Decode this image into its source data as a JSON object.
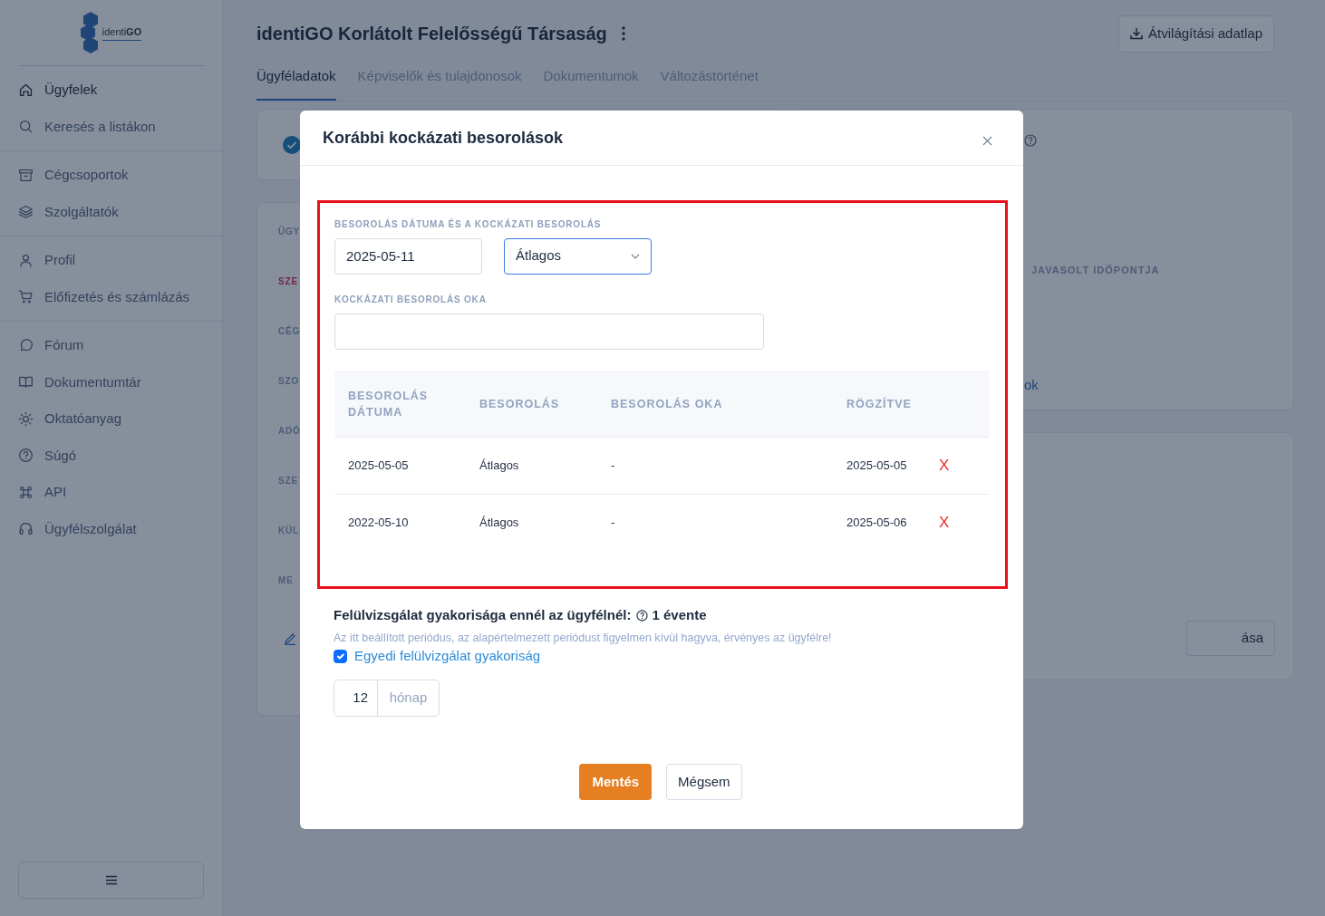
{
  "sidebar": {
    "logo_text": "identi**GO**",
    "groups": [
      [
        {
          "label": "Ügyfelek",
          "selected": true
        },
        {
          "label": "Keresés a listákon",
          "selected": false
        }
      ],
      [
        {
          "label": "Cégcsoportok",
          "selected": false
        },
        {
          "label": "Szolgáltatók",
          "selected": false
        }
      ],
      [
        {
          "label": "Profil",
          "selected": false
        },
        {
          "label": "Előfizetés és számlázás",
          "selected": false
        }
      ],
      [
        {
          "label": "Fórum",
          "selected": false
        },
        {
          "label": "Dokumentumtár",
          "selected": false
        },
        {
          "label": "Oktatóanyag",
          "selected": false
        },
        {
          "label": "Súgó",
          "selected": false
        },
        {
          "label": "API",
          "selected": false
        },
        {
          "label": "Ügyfélszolgálat",
          "selected": false
        }
      ]
    ]
  },
  "page": {
    "title": "identiGO Korlátolt Felelősségű Társaság",
    "download_button": "Átvilágítási adatlap",
    "tabs": [
      {
        "label": "Ügyféladatok",
        "selected": true
      },
      {
        "label": "Képviselők és tulajdonosok",
        "selected": false
      },
      {
        "label": "Dokumentumok",
        "selected": false
      },
      {
        "label": "Változástörténet",
        "selected": false
      }
    ],
    "left_labels": [
      {
        "text": "ÜGY",
        "alert": false
      },
      {
        "text": "SZE",
        "alert": true
      },
      {
        "text": "CÉG",
        "alert": false
      },
      {
        "text": "SZO",
        "alert": false
      },
      {
        "text": "ADÓ",
        "alert": false
      },
      {
        "text": "SZE",
        "alert": false
      },
      {
        "text": "KÜL",
        "alert": false
      },
      {
        "text": "ME",
        "alert": false
      }
    ],
    "right_label": "JAVASOLT IDŐPONTJA",
    "right_link": "ok",
    "right_button": "ása"
  },
  "modal": {
    "title": "Korábbi kockázati besorolások",
    "section_label": "BESOROLÁS DÁTUMA ÉS A KOCKÁZATI BESOROLÁS",
    "date_value": "2025-05-11",
    "rating_value": "Átlagos",
    "reason_label": "KOCKÁZATI BESOROLÁS OKA",
    "table": {
      "columns": [
        "BESOROLÁS DÁTUMA",
        "BESOROLÁS",
        "BESOROLÁS OKA",
        "RÖGZÍTVE"
      ],
      "rows": [
        {
          "cells": [
            "2025-05-05",
            "Átlagos",
            "-",
            "2025-05-05"
          ],
          "delete": "X"
        },
        {
          "cells": [
            "2022-05-10",
            "Átlagos",
            "-",
            "2025-05-06"
          ],
          "delete": "X"
        }
      ]
    },
    "review_label": "Felülvizsgálat gyakorisága ennél az ügyfélnél:",
    "review_value": "1 évente",
    "hint": "Az itt beállított periódus, az alapértelmezett periódust figyelmen kívül hagyva, érvényes az ügyfélre!",
    "custom": {
      "label": "Egyedi felülvizgálat gyakoriság",
      "checked": true
    },
    "months_value": "12",
    "months_unit": "hónap",
    "save_button": "Mentés",
    "cancel_button": "Mégsem"
  }
}
